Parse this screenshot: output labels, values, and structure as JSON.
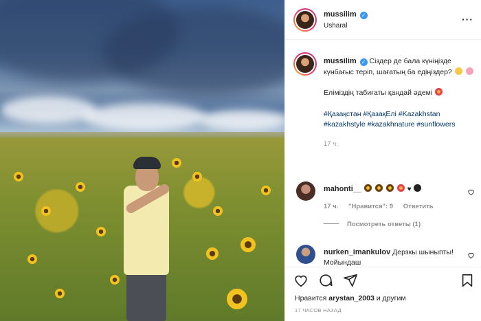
{
  "post": {
    "username": "mussilim",
    "location": "Usharal",
    "more_icon": "more-horizontal-icon",
    "caption_line1": "Сіздер де бала күніңізде күнбағыс теріп, шағатың ба едіңіздер?",
    "caption_line2": "Еліміздің табиғаты қандай әдемі",
    "hashtags": "#Қазақстан #ҚазақЕлі #Kazakhstan #kazakhstyle #kazakhnature #sunflowers",
    "time": "17 ч."
  },
  "comments": [
    {
      "username": "mahonti__",
      "text": "",
      "time": "17 ч.",
      "likes": "\"Нравится\": 9",
      "reply": "Ответить",
      "view_replies": "Посмотреть ответы (1)"
    },
    {
      "username": "nurken_imankulov",
      "text": "Дерзкы шыныпты! Мойындаш"
    }
  ],
  "actions": {
    "likes_prefix": "Нравится",
    "liked_by": "arystan_2003",
    "likes_suffix": "и другим",
    "date": "17 ЧАСОВ НАЗАД"
  },
  "colors": {
    "accent": "#3897f0",
    "hashtag": "#00376b",
    "muted": "#8e8e8e"
  }
}
